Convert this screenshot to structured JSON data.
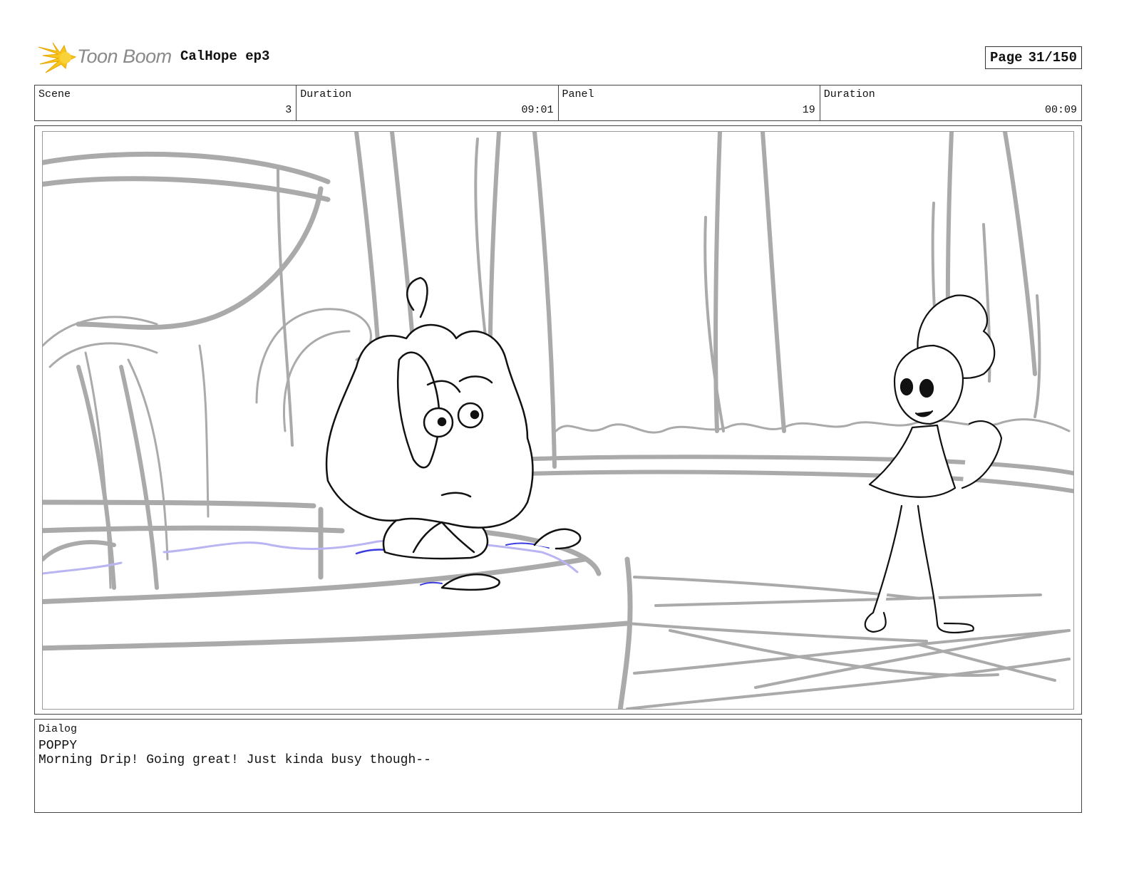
{
  "header": {
    "logo_text": "Toon Boom",
    "project_title": "CalHope ep3",
    "page_label": "Page",
    "page_value": "31/150"
  },
  "info": {
    "scene_label": "Scene",
    "scene_value": "3",
    "scene_duration_label": "Duration",
    "scene_duration_value": "09:01",
    "panel_label": "Panel",
    "panel_value": "19",
    "panel_duration_label": "Duration",
    "panel_duration_value": "00:09"
  },
  "dialog": {
    "label": "Dialog",
    "character": "POPPY",
    "line": "Morning Drip! Going great! Just kinda busy though--"
  },
  "colors": {
    "sketch_gray": "#aaaaaa",
    "ink": "#111111",
    "water_blue": "#3a3ae0",
    "water_light": "#b9b4f2",
    "logo_yellow": "#f7c51e",
    "logo_text": "#8a8a8a"
  }
}
